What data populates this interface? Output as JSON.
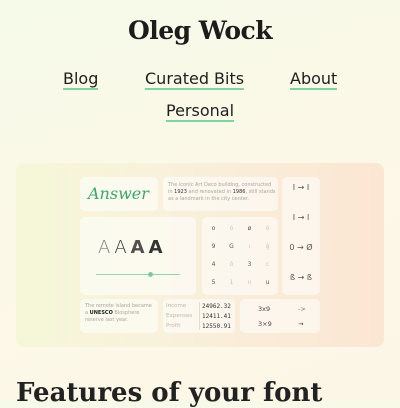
{
  "site": {
    "title": "Oleg Wock"
  },
  "nav": {
    "blog": "Blog",
    "curated": "Curated Bits",
    "about": "About",
    "personal": "Personal"
  },
  "hero": {
    "answer_word": "Answer",
    "text_card": {
      "pre": "The iconic Art Deco building, constructed in ",
      "year1": "1923",
      "mid": " and renovated in ",
      "year2": "1986",
      "post": ", still stands as a landmark in the city center."
    },
    "arrow_pairs": [
      {
        "from": "I",
        "to": "I"
      },
      {
        "from": "I",
        "to": "l"
      },
      {
        "from": "0",
        "to": "Ø"
      },
      {
        "from": "ß",
        "to": "ß"
      }
    ],
    "weight_samples": [
      "A",
      "A",
      "A",
      "A"
    ],
    "glyph_grid": [
      [
        "o",
        "ó",
        "ø",
        "ö"
      ],
      [
        "9",
        "G",
        "ı",
        "ǵ"
      ],
      [
        "4",
        "ô",
        "3",
        "c"
      ],
      [
        "5",
        "1",
        "ıı",
        "u"
      ]
    ],
    "unesco_card": {
      "pre": "The remote island became a ",
      "bold": "UNESCO",
      "post": " Biosphere reserve last year."
    },
    "table": [
      {
        "label": "Income",
        "value": "24962.32"
      },
      {
        "label": "Expenses",
        "value": "12411.41"
      },
      {
        "label": "Profit",
        "value": "12550.91"
      }
    ],
    "ops": [
      {
        "expr": "3x9",
        "result": "->"
      },
      {
        "expr": "3×9",
        "result": "→"
      }
    ]
  },
  "section": {
    "heading": "Features of your font"
  }
}
